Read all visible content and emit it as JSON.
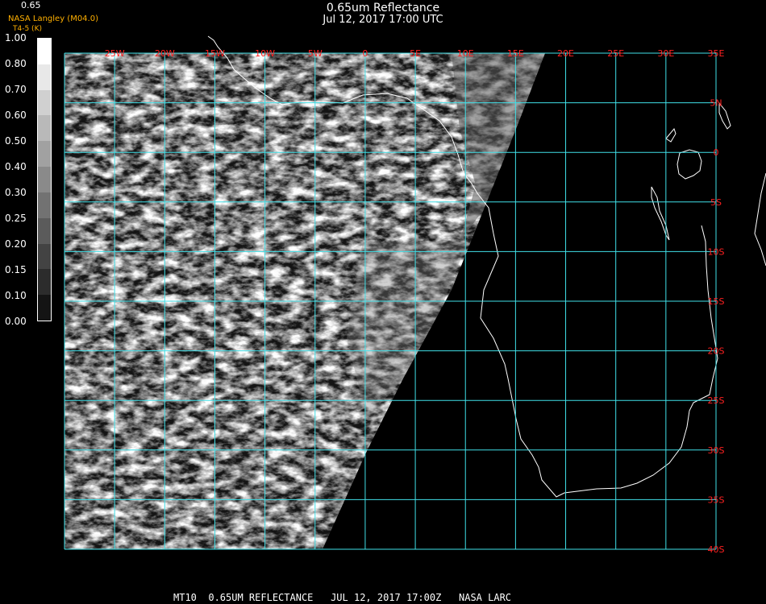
{
  "title": "0.65um Reflectance",
  "subtitle": "Jul 12, 2017 17:00 UTC",
  "legend": {
    "label": "0.65",
    "credit": "NASA Langley (M04.0)",
    "credit2": "T4-5 (K)",
    "ticks": [
      "1.00",
      "0.80",
      "0.70",
      "0.60",
      "0.50",
      "0.40",
      "0.30",
      "0.25",
      "0.20",
      "0.15",
      "0.10",
      "0.00"
    ]
  },
  "map": {
    "lon_labels": [
      "25W",
      "20W",
      "15W",
      "10W",
      "5W",
      "0",
      "5E",
      "10E",
      "15E",
      "20E",
      "25E",
      "30E",
      "35E"
    ],
    "lat_labels": [
      "5N",
      "0",
      "5S",
      "10S",
      "15S",
      "20S",
      "25S",
      "30S",
      "35S",
      "40S"
    ],
    "lon_range": [
      -30,
      35
    ],
    "lat_range": [
      -40,
      10
    ],
    "grid_color": "#40e0e8",
    "label_color": "#ff2020",
    "coastline_color": "#ffffff"
  },
  "footer": "MT10  0.65UM REFLECTANCE   JUL 12, 2017 17:00Z   NASA LARC"
}
